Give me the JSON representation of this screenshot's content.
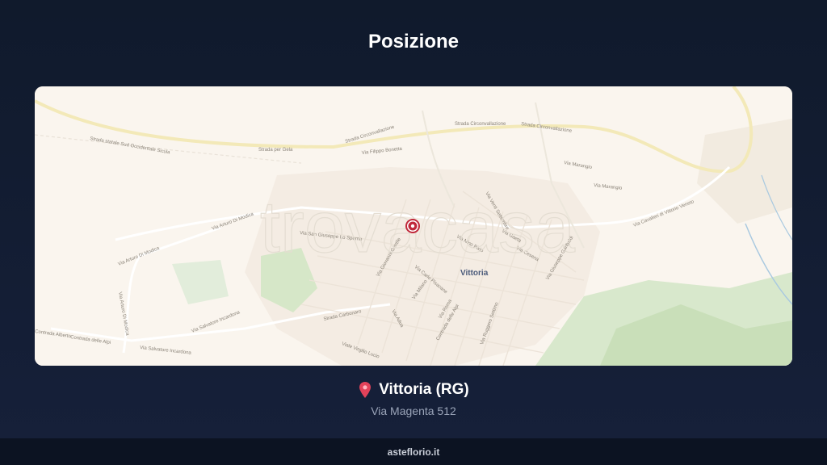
{
  "header": {
    "title": "Posizione"
  },
  "map": {
    "watermark": "trovacasa",
    "city_label": "Vittoria",
    "streets": [
      "Strada statale Sud Occidentale Sicula",
      "Strada per Gela",
      "Strada Circonvallazione",
      "Strada Circonvallazione",
      "Strada Circonvallazione",
      "Via Filippo Bonetta",
      "Via Marangio",
      "Via Marangio",
      "Via Cavalieri di Vittorio Veneto",
      "Via Arturo Di Modica",
      "Via Arturo Di Modica",
      "Via Arturo Di Modica",
      "Via San Giuseppe Lo Sperno",
      "Via Nino Bixio",
      "Via Gaeta",
      "Via Cesena",
      "Via Giovanni Gentile",
      "Via Carlo Pisacane",
      "Via Ruggero Settimo",
      "Strada Carbonaro",
      "Via Salvatore Incardona",
      "Via Salvatore Incardona",
      "Contrada delle Alpi",
      "Via Adua",
      "Via Milano",
      "Via Roma",
      "Via Giuseppe Garibaldi",
      "Via Venti Settembre",
      "Contrada Alberto",
      "Contrada delle Alpi",
      "Viale Virgilio Lucio"
    ]
  },
  "location": {
    "city": "Vittoria (RG)",
    "address": "Via Magenta 512"
  },
  "footer": {
    "brand": "asteflorio.it"
  },
  "colors": {
    "background": "#121b2e",
    "map_background": "#faf5ee",
    "pin": "#c0283a",
    "road_major": "#f3e9b8",
    "green_area": "#c9dfb9"
  },
  "icons": {
    "location_pin": "map-pin-icon",
    "map_marker": "map-marker-icon"
  }
}
